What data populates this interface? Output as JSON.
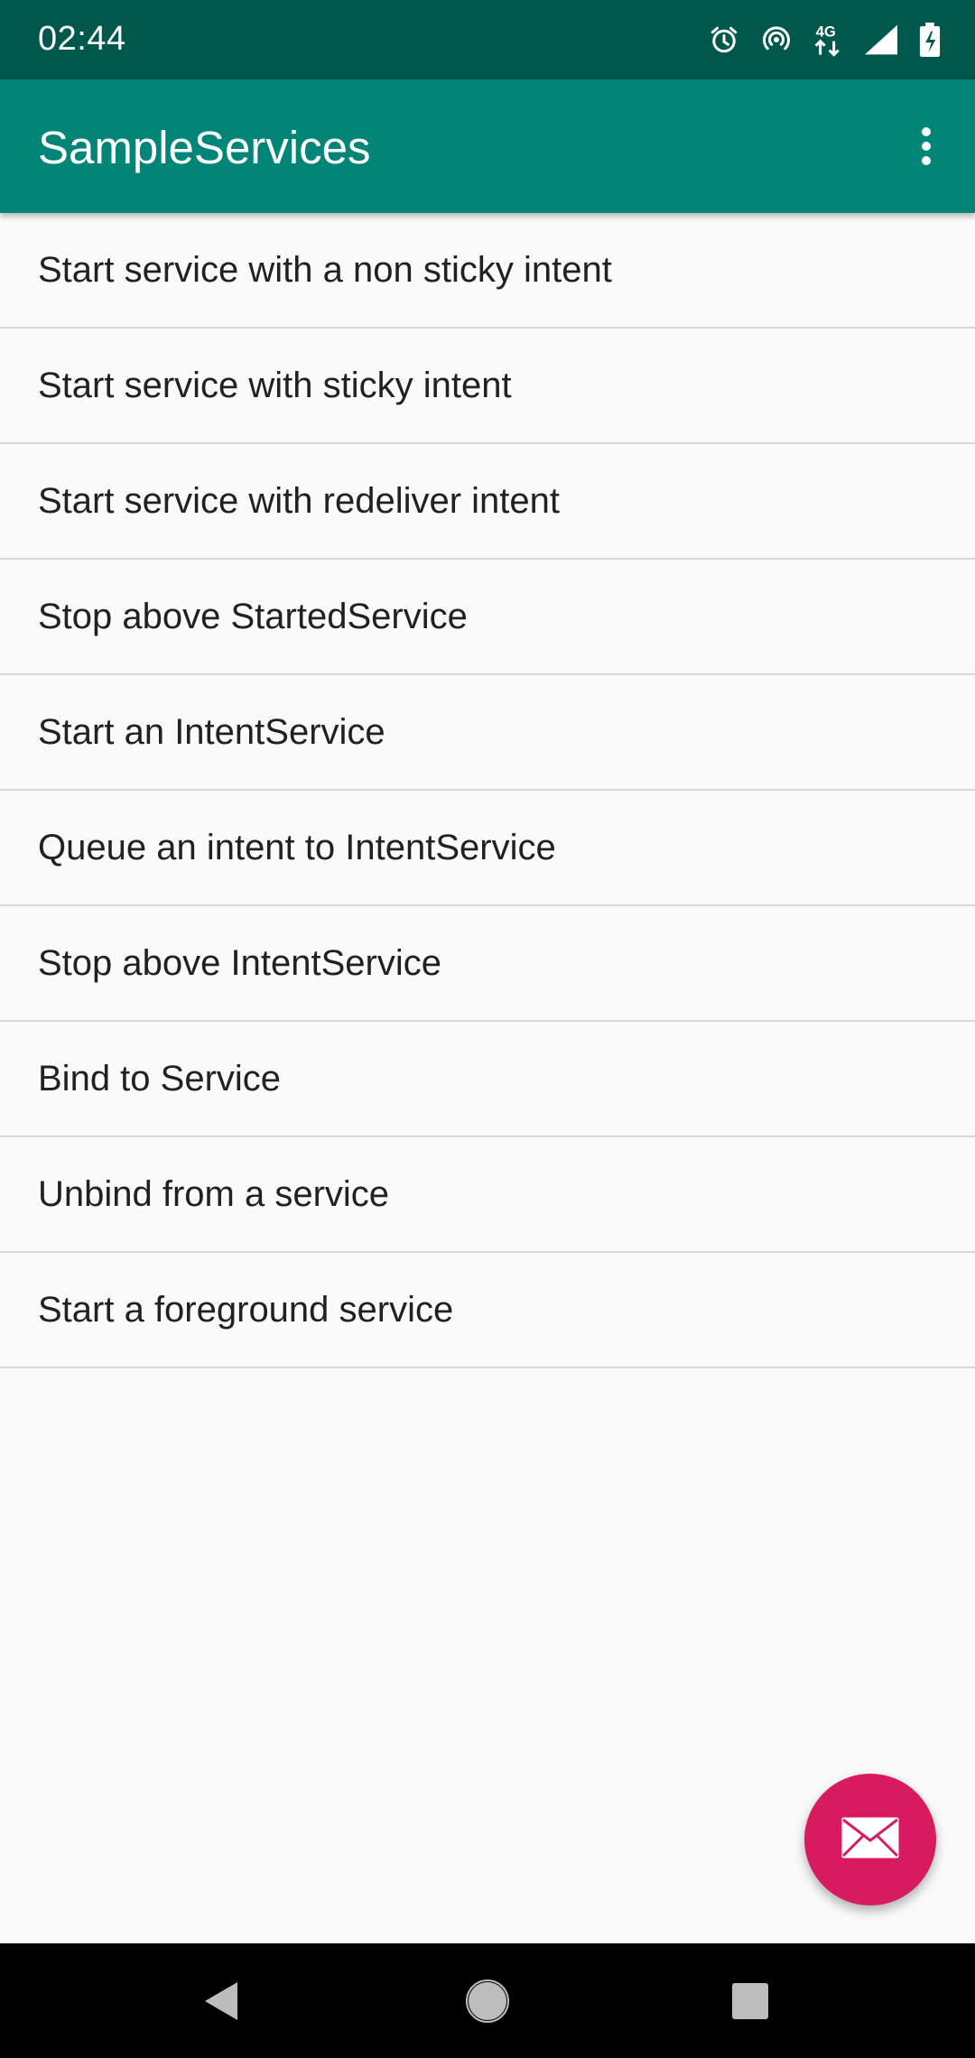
{
  "status_bar": {
    "time": "02:44",
    "icons": [
      "alarm-icon",
      "hotspot-icon",
      "4g-data-icon",
      "signal-icon",
      "battery-icon"
    ],
    "background": "#00574b"
  },
  "app_bar": {
    "title": "SampleServices",
    "background": "#008577",
    "menu_icon": "more-vert-icon"
  },
  "list": {
    "items": [
      {
        "label": "Start service with a non sticky intent"
      },
      {
        "label": "Start service with sticky intent"
      },
      {
        "label": "Start service with redeliver intent"
      },
      {
        "label": "Stop above StartedService"
      },
      {
        "label": "Start an IntentService"
      },
      {
        "label": "Queue an intent to IntentService"
      },
      {
        "label": "Stop above IntentService"
      },
      {
        "label": "Bind to Service"
      },
      {
        "label": "Unbind from a service"
      },
      {
        "label": "Start a foreground service"
      }
    ]
  },
  "fab": {
    "icon": "email-icon",
    "color": "#d81b60"
  },
  "nav_bar": {
    "buttons": [
      "back-icon",
      "home-icon",
      "recents-icon"
    ]
  }
}
